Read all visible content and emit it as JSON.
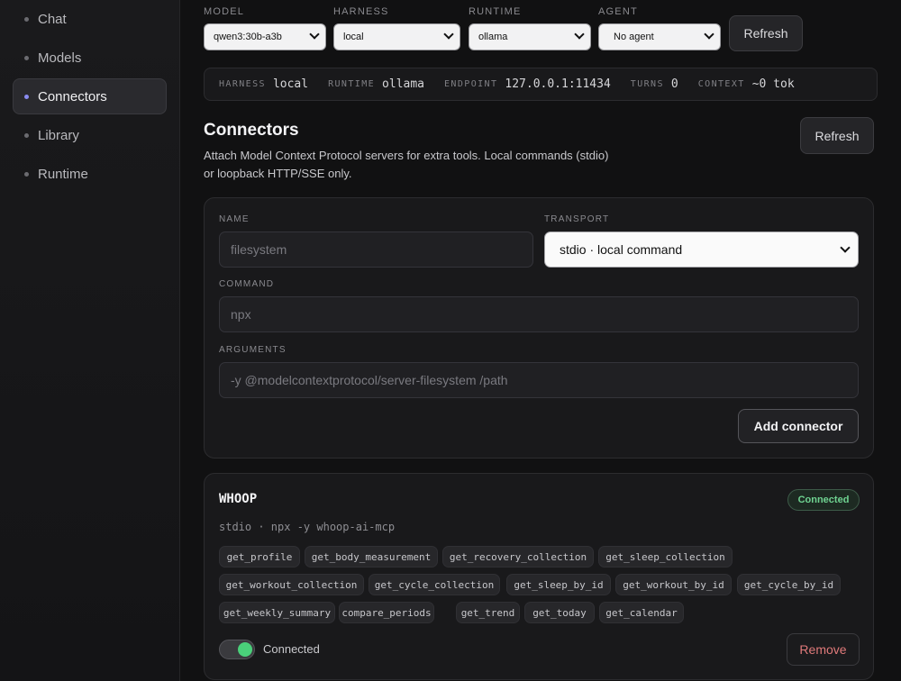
{
  "sidebar": {
    "items": [
      {
        "label": "Chat"
      },
      {
        "label": "Models"
      },
      {
        "label": "Connectors"
      },
      {
        "label": "Library"
      },
      {
        "label": "Runtime"
      }
    ]
  },
  "toolbar": {
    "model_label": "MODEL",
    "model_value": "qwen3:30b-a3b",
    "harness_label": "HARNESS",
    "harness_value": "local",
    "runtime_label": "RUNTIME",
    "runtime_value": "ollama",
    "agent_label": "AGENT",
    "agent_value": "No agent",
    "refresh_label": "Refresh"
  },
  "status": {
    "harness_key": "HARNESS",
    "harness_value": "local",
    "runtime_key": "RUNTIME",
    "runtime_value": "ollama",
    "endpoint_key": "ENDPOINT",
    "endpoint_value": "127.0.0.1:11434",
    "turns_key": "TURNS",
    "turns_value": "0",
    "context_key": "CONTEXT",
    "context_value": "~0 tok"
  },
  "connectors": {
    "title": "Connectors",
    "description": "Attach Model Context Protocol servers for extra tools. Local commands (stdio) or loopback HTTP/SSE only.",
    "refresh_label": "Refresh"
  },
  "form": {
    "name_label": "NAME",
    "name_placeholder": "filesystem",
    "transport_label": "TRANSPORT",
    "transport_value": "stdio · local command",
    "command_label": "COMMAND",
    "command_placeholder": "npx",
    "arguments_label": "ARGUMENTS",
    "arguments_placeholder": "-y @modelcontextprotocol/server-filesystem /path",
    "add_label": "Add connector"
  },
  "connector": {
    "name": "WHOOP",
    "status_badge": "Connected",
    "command": "stdio · npx -y whoop-ai-mcp",
    "tools": [
      "get_profile",
      "get_body_measurement",
      "get_recovery_collection",
      "get_sleep_collection",
      "get_workout_collection",
      "get_cycle_collection",
      "get_sleep_by_id",
      "get_workout_by_id",
      "get_cycle_by_id",
      "get_weekly_summary",
      "compare_periods",
      "get_trend",
      "get_today",
      "get_calendar"
    ],
    "toggle_label": "Connected",
    "toggle_on": true,
    "remove_label": "Remove"
  },
  "colors": {
    "accent": "#8a8cf0",
    "connected": "#4ad07a",
    "remove": "#e07a7a"
  }
}
